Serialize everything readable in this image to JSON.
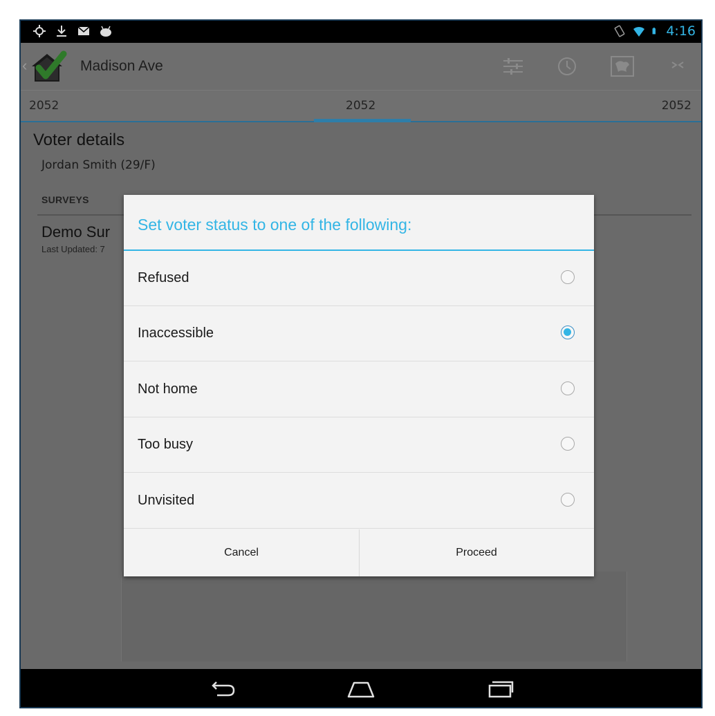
{
  "status_bar": {
    "time": "4:16",
    "left_icons": [
      "location-icon",
      "download-icon",
      "gmail-icon",
      "android-icon"
    ],
    "right_icons": [
      "rotate-icon",
      "wifi-icon",
      "battery-icon"
    ]
  },
  "action_bar": {
    "title": "Madison Ave",
    "icons": [
      "sliders-icon",
      "clock-icon",
      "map-icon",
      "collapse-icon"
    ]
  },
  "tabs": {
    "left": "2052",
    "center": "2052",
    "right": "2052"
  },
  "content": {
    "voter_title": "Voter details",
    "voter_sub": "Jordan Smith (29/F)",
    "surveys_header": "SURVEYS",
    "survey_name": "Demo Sur",
    "survey_updated": "Last Updated: 7"
  },
  "dialog": {
    "title": "Set voter status to one of the following:",
    "options": [
      {
        "label": "Refused",
        "selected": false
      },
      {
        "label": "Inaccessible",
        "selected": true
      },
      {
        "label": "Not home",
        "selected": false
      },
      {
        "label": "Too busy",
        "selected": false
      },
      {
        "label": "Unvisited",
        "selected": false
      }
    ],
    "cancel_label": "Cancel",
    "proceed_label": "Proceed"
  },
  "nav_bar": {
    "icons": [
      "back-icon",
      "home-icon",
      "recents-icon"
    ]
  },
  "colors": {
    "accent": "#33b5e5",
    "tab_indicator": "#2e7ea9",
    "dim_background": "#6a6a6a"
  }
}
